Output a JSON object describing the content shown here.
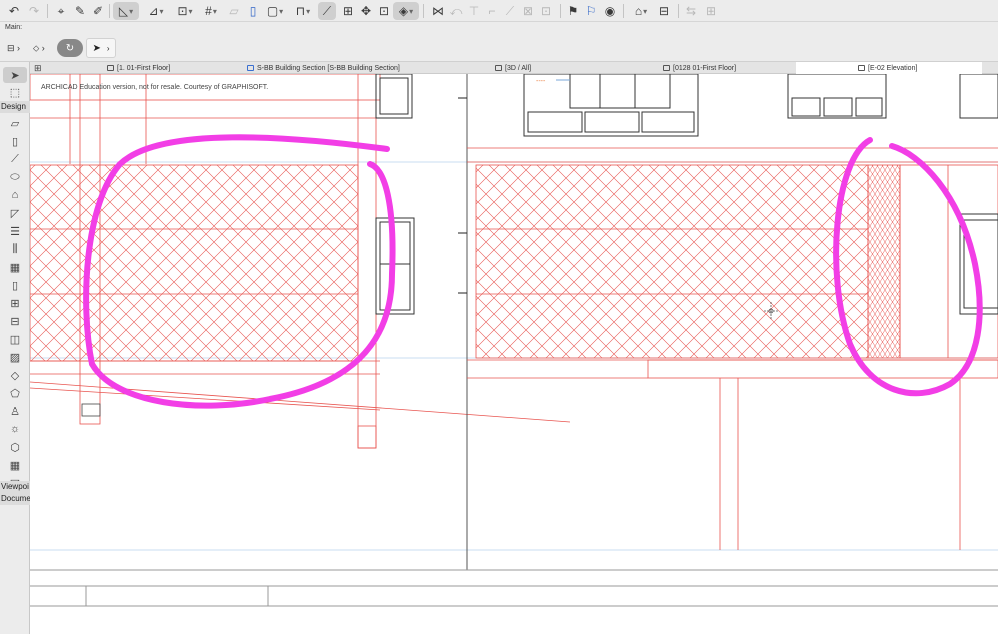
{
  "infobox": {
    "main_label": "Main:"
  },
  "tabs": [
    {
      "label": "[1. 01-First Floor]",
      "icon": "floorplan-icon",
      "active": false
    },
    {
      "label": "S-BB Building Section [S-BB Building Section]",
      "icon": "section-icon",
      "active": false
    },
    {
      "label": "[3D / All]",
      "icon": "3d-window-icon",
      "active": false
    },
    {
      "label": "[0128 01-First Floor]",
      "icon": "layout-icon",
      "active": false
    },
    {
      "label": "[E-02 Elevation]",
      "icon": "elevation-icon",
      "active": true
    }
  ],
  "toolbox": {
    "design_label": "Design",
    "viewpoint_label": "Viewpoi",
    "document_label": "Docume"
  },
  "drawing": {
    "watermark": "ARCHICAD Education version, not for resale. Courtesy of GRAPHISOFT.",
    "hatch_color": "#e8544f",
    "annotation_color": "#f23ee6",
    "guide_color": "#c9def0",
    "dim_label": "----"
  },
  "colors": {
    "toolbar_bg": "#ececec",
    "tab_active_bg": "#ffffff",
    "section_accent": "#3a6fd0"
  }
}
